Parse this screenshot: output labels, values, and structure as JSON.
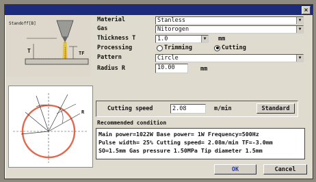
{
  "title_bar": {
    "close_glyph": "×"
  },
  "diagram": {
    "labels": {
      "standoff": "Standoff[B]",
      "t": "T",
      "tf": "TF",
      "radius": "R"
    }
  },
  "form": {
    "material": {
      "label": "Material",
      "value": "Stanless"
    },
    "gas": {
      "label": "Gas",
      "value": "Nitorogen"
    },
    "thickness": {
      "label": "Thickness T",
      "value": "1.0",
      "unit": "mm"
    },
    "processing": {
      "label": "Processing",
      "options": [
        "Trimming",
        "Cutting"
      ],
      "selected": "Cutting"
    },
    "pattern": {
      "label": "Pattern",
      "value": "Circle"
    },
    "radius": {
      "label": "Radius R",
      "value": "10.00",
      "unit": "mm"
    }
  },
  "speed": {
    "label": "Cutting speed",
    "value": "2.08",
    "unit": "m/min",
    "button": "Standard"
  },
  "recommended": {
    "title": "Recommended condition",
    "lines": [
      "Main power=1022W  Base power=  1W  Frequency=500Hz",
      "Pulse width= 25%  Cutting speed= 2.08m/min  TF=-3.0mm",
      "SO=1.5mm  Gas pressure 1.50MPa  Tip diameter 1.5mm"
    ]
  },
  "buttons": {
    "ok": "OK",
    "cancel": "Cancel"
  },
  "colors": {
    "title_bar": "#1d2b7c",
    "dialog_bg": "#e0dbcf",
    "circle": "#e06a50",
    "ok_text": "#2a3aa0"
  }
}
